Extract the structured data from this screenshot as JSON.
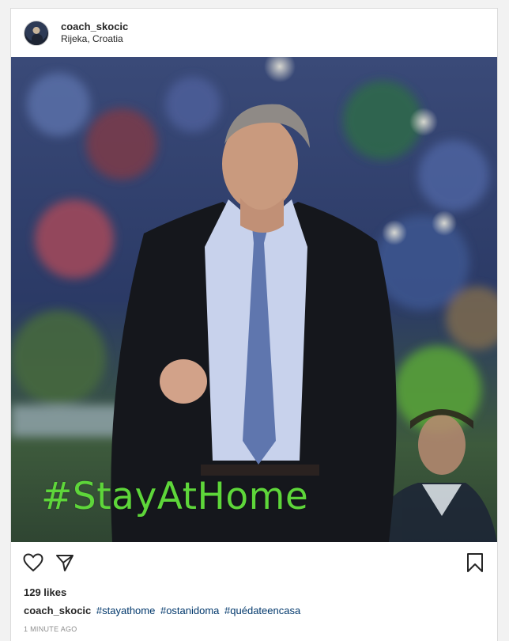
{
  "header": {
    "username": "coach_skocic",
    "location": "Rijeka, Croatia"
  },
  "photo": {
    "overlay_text": "#StayAtHome",
    "overlay_color": "#5ed63a"
  },
  "actions": {
    "like_icon": "heart-icon",
    "share_icon": "send-icon",
    "save_icon": "bookmark-icon"
  },
  "likes": "129 likes",
  "caption": {
    "username": "coach_skocic",
    "tags": [
      "#stayathome",
      "#ostanidoma",
      "#quédateencasa"
    ]
  },
  "timestamp": "1 MINUTE AGO"
}
